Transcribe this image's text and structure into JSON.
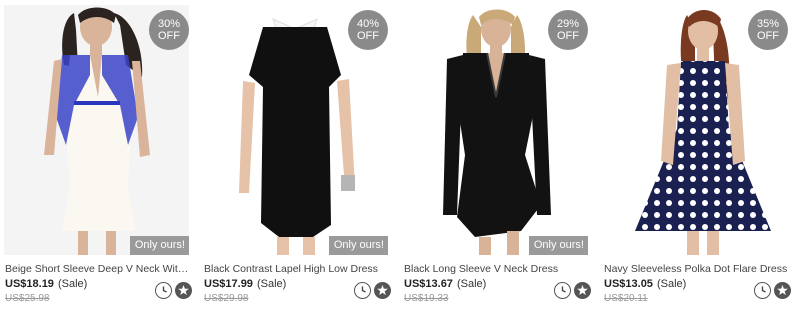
{
  "products": [
    {
      "discount_pct": "30%",
      "discount_off": "OFF",
      "exclusive_label": "Only ours!",
      "name": "Beige Short Sleeve Deep V Neck With ...",
      "price": "US$18.19",
      "sale_label": "(Sale)",
      "old_price": "US$25.98",
      "icons": [
        "clock-icon",
        "star-icon"
      ]
    },
    {
      "discount_pct": "40%",
      "discount_off": "OFF",
      "exclusive_label": "Only ours!",
      "name": "Black Contrast Lapel High Low Dress",
      "price": "US$17.99",
      "sale_label": "(Sale)",
      "old_price": "US$29.98",
      "icons": [
        "clock-icon",
        "star-icon"
      ]
    },
    {
      "discount_pct": "29%",
      "discount_off": "OFF",
      "exclusive_label": "Only ours!",
      "name": "Black Long Sleeve V Neck Dress",
      "price": "US$13.67",
      "sale_label": "(Sale)",
      "old_price": "US$19.33",
      "icons": [
        "clock-icon",
        "star-icon"
      ]
    },
    {
      "discount_pct": "35%",
      "discount_off": "OFF",
      "exclusive_label": "",
      "name": "Navy Sleeveless Polka Dot Flare Dress",
      "price": "US$13.05",
      "sale_label": "(Sale)",
      "old_price": "US$20.11",
      "icons": [
        "clock-icon",
        "star-icon"
      ]
    }
  ],
  "colors": {
    "badge": "#8a8a8a",
    "exclusive_tag": "#9a9a9a",
    "old_price": "#999999"
  }
}
